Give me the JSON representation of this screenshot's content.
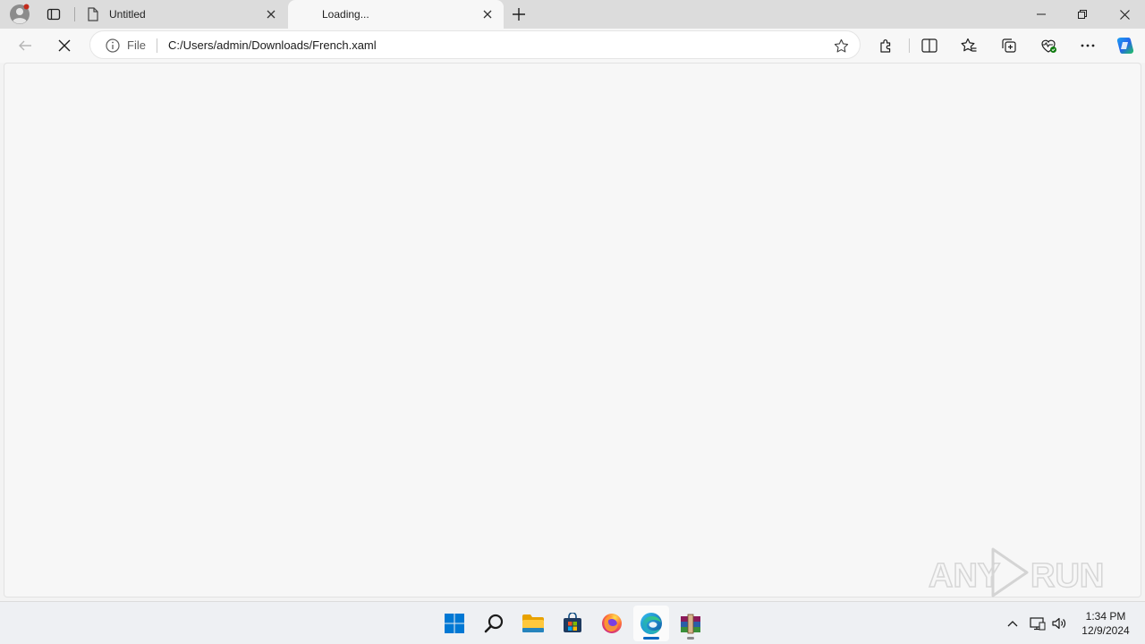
{
  "browser": {
    "tabs": [
      {
        "label": "Untitled",
        "active": false
      },
      {
        "label": "Loading...",
        "active": true
      }
    ],
    "address": {
      "scheme": "File",
      "url": "C:/Users/admin/Downloads/French.xaml"
    },
    "status": "loading"
  },
  "watermark": {
    "text": "ANY RUN"
  },
  "taskbar": {
    "apps": [
      "start-icon",
      "search-icon",
      "file-explorer-icon",
      "microsoft-store-icon",
      "firefox-icon",
      "edge-icon",
      "winrar-icon"
    ],
    "active_app": "edge-icon",
    "clock": {
      "time": "1:34 PM",
      "date": "12/9/2024"
    }
  },
  "colors": {
    "accent": "#0067c0",
    "titlebar": "#dcdcdc",
    "content": "#f7f7f7"
  }
}
